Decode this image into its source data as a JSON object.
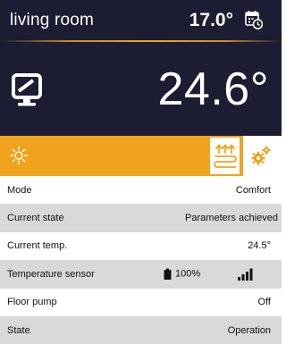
{
  "header": {
    "room_name": "living room",
    "set_temperature": "17.0°",
    "current_temperature": "24.6°",
    "icons": [
      "calendar-clock-icon",
      "monitor-icon"
    ]
  },
  "mode_bar": {
    "icons": [
      "sun-icon",
      "floor-heating-icon",
      "gears-icon"
    ],
    "colors": {
      "accent": "#f0a31c",
      "header_bg": "#1c1d33"
    }
  },
  "rows": [
    {
      "label": "Mode",
      "value": "Comfort"
    },
    {
      "label": "Current state",
      "value": "Parameters achieved"
    },
    {
      "label": "Current temp.",
      "value": "24.5°"
    },
    {
      "label": "Temperature sensor",
      "battery": "100%",
      "icons": [
        "battery-icon",
        "signal-icon"
      ]
    },
    {
      "label": "Floor pump",
      "value": "Off"
    },
    {
      "label": "State",
      "value": "Operation"
    }
  ]
}
